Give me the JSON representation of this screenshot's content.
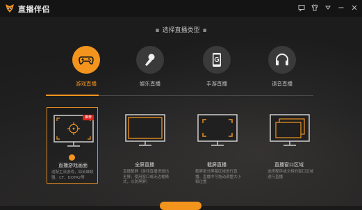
{
  "app": {
    "title": "直播伴侣"
  },
  "section": {
    "title": "选择直播类型"
  },
  "types": [
    {
      "label": "游戏直播",
      "icon": "gamepad-icon",
      "active": true
    },
    {
      "label": "娱乐直播",
      "icon": "microphone-icon",
      "active": false
    },
    {
      "label": "手游直播",
      "icon": "phone-icon",
      "active": false
    },
    {
      "label": "语音直播",
      "icon": "headphones-icon",
      "active": false
    }
  ],
  "modes": [
    {
      "title": "直播游戏画面",
      "badge": "推荐",
      "desc": "适配主流游戏，如英雄联盟、CF、DOTA2等",
      "icon": "game-capture-icon",
      "active": true
    },
    {
      "title": "全屏直播",
      "desc": "直播整屏（游戏直播请退出全屏，使用窗口或无边框模式，以防黑屏）",
      "icon": "fullscreen-icon",
      "active": false
    },
    {
      "title": "截屏直播",
      "desc": "截屏部分屏幕区域进行直播，直播中可拖动调整大小和位置",
      "icon": "region-capture-icon",
      "active": false
    },
    {
      "title": "直播窗口区域",
      "desc": "选择程序或文档的窗口区域进行直播",
      "icon": "window-capture-icon",
      "active": false
    }
  ],
  "colors": {
    "accent": "#f3941d",
    "badge": "#d9241d",
    "background": "#1c1c1d"
  }
}
